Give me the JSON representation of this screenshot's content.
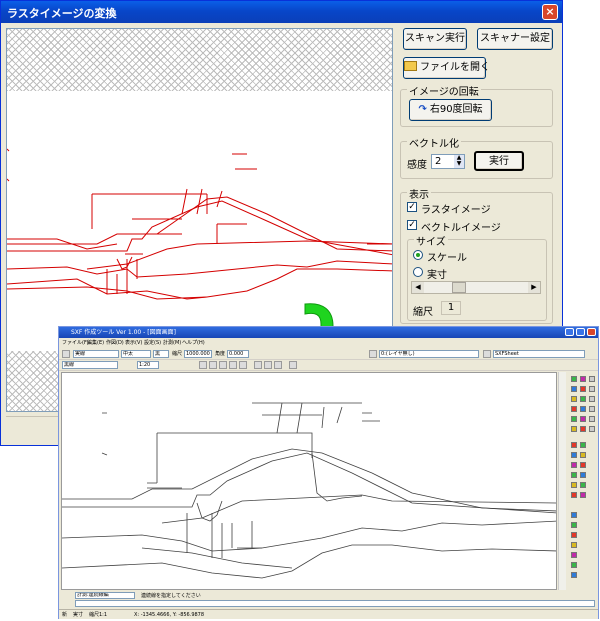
{
  "dialog": {
    "title": "ラスタイメージの変換",
    "close_label": "×",
    "buttons": {
      "scan": "スキャン実行",
      "scanner_settings": "スキャナー設定",
      "open_file": "ファイルを開く"
    },
    "rotate_group": {
      "legend": "イメージの回転",
      "button": "右90度回転",
      "icon": "rotate-cw-icon"
    },
    "vector_group": {
      "legend": "ベクトル化",
      "sensitivity_label": "感度",
      "sensitivity_value": "2",
      "run_button": "実行"
    },
    "display_group": {
      "legend": "表示",
      "raster_label": "ラスタイメージ",
      "raster_checked": true,
      "vector_label": "ベクトルイメージ",
      "vector_checked": true,
      "size_group": {
        "legend": "サイズ",
        "scale_label": "スケール",
        "actual_label": "実寸",
        "selected": "scale",
        "scale_ratio_label": "縮尺",
        "scale_ratio_value": "1"
      }
    },
    "raster_color": "#d40000"
  },
  "cad_window": {
    "title": "SXF 作成ツール Ver 1.00 - [図面画面]",
    "menu": [
      "ファイル(F)",
      "編集(E)",
      "作図(D)",
      "表示(V)",
      "設定(S)",
      "計測(M)",
      "ヘルプ(H)"
    ],
    "toolbar1": {
      "line_type": "実線",
      "width": "中太",
      "color": "黒",
      "scale_label": "縮尺",
      "scale_value": "1000.000",
      "angle_label": "角度",
      "angle_value": "0.000",
      "layer": "0:(レイヤ無し)",
      "sheet": "SXFSheet"
    },
    "toolbar2": {
      "pen": "黒線",
      "scale2": "1:20"
    },
    "command": {
      "history": "計測:連続線編",
      "prompt": "連続線を指定してください"
    },
    "status": {
      "mode1": "新",
      "mode2": "実寸",
      "mode3": "縮尺1:1",
      "coords": "X: -1345.4666, Y: -856.9878"
    },
    "drawing_color": "#404040"
  }
}
